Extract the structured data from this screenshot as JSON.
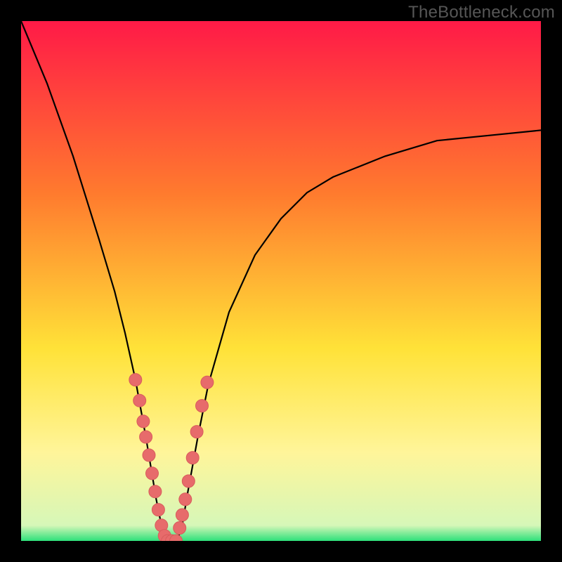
{
  "watermark": "TheBottleneck.com",
  "colors": {
    "frame": "#000000",
    "grad_top": "#ff1a47",
    "grad_mid1": "#ff7a2e",
    "grad_mid2": "#ffe238",
    "grad_pale": "#fff59a",
    "grad_green": "#2de07a",
    "curve": "#000000",
    "marker_fill": "#e76b6b",
    "marker_stroke": "#d85c5c"
  },
  "chart_data": {
    "type": "line",
    "title": "",
    "xlabel": "",
    "ylabel": "",
    "xlim": [
      0,
      100
    ],
    "ylim": [
      0,
      100
    ],
    "series": [
      {
        "name": "bottleneck-curve",
        "x": [
          0,
          5,
          10,
          15,
          18,
          20,
          22,
          24,
          26,
          27,
          28,
          29,
          30,
          31,
          32,
          34,
          36,
          40,
          45,
          50,
          55,
          60,
          70,
          80,
          90,
          100
        ],
        "values": [
          100,
          88,
          74,
          58,
          48,
          40,
          31,
          20,
          8,
          3,
          0,
          0,
          0,
          3,
          9,
          20,
          30,
          44,
          55,
          62,
          67,
          70,
          74,
          77,
          78,
          79
        ]
      }
    ],
    "markers": {
      "name": "highlighted-points",
      "x": [
        22.0,
        22.8,
        23.5,
        24.0,
        24.6,
        25.2,
        25.8,
        26.4,
        27.0,
        27.6,
        28.2,
        29.0,
        29.8,
        30.5,
        31.0,
        31.6,
        32.2,
        33.0,
        33.8,
        34.8,
        35.8
      ],
      "values": [
        31.0,
        27.0,
        23.0,
        20.0,
        16.5,
        13.0,
        9.5,
        6.0,
        3.0,
        1.0,
        0.0,
        0.0,
        0.0,
        2.5,
        5.0,
        8.0,
        11.5,
        16.0,
        21.0,
        26.0,
        30.5
      ]
    }
  }
}
